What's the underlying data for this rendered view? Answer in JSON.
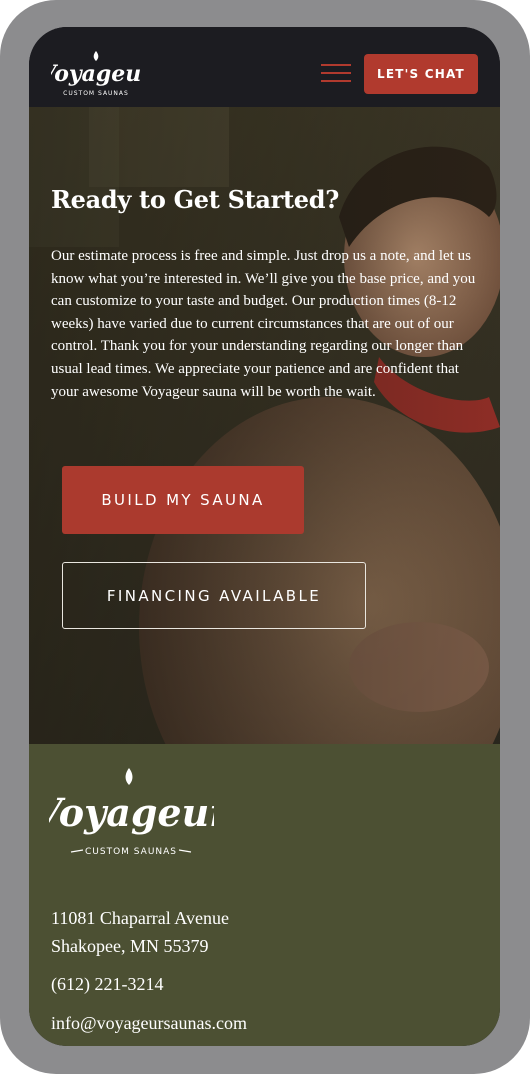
{
  "header": {
    "logo": {
      "word": "Voyageur",
      "tagline": "CUSTOM SAUNAS"
    },
    "menu_icon": "hamburger-menu-icon",
    "chat_button": "LET'S CHAT",
    "accent_color": "#b13a2e"
  },
  "hero": {
    "title": "Ready to Get Started?",
    "text": "Our estimate process is free and simple. Just drop us a note, and let us know what you’re interested in. We’ll give you the base price, and you can customize to your taste and budget. Our production times (8-12 weeks) have varied due to current circumstances that are out of our control. Thank you for your understanding regarding our longer than usual lead times. We appreciate your patience and are confident that your awesome Voyageur sauna will be worth the wait.",
    "primary_button": "BUILD MY SAUNA",
    "secondary_button": "FINANCING AVAILABLE"
  },
  "footer": {
    "logo": {
      "word": "Voyageur",
      "tagline": "CUSTOM SAUNAS"
    },
    "address_line1": "11081 Chaparral Avenue",
    "address_line2": "Shakopee, MN 55379",
    "phone": "(612) 221-3214",
    "email": "info@voyageursaunas.com",
    "background_color": "#4c5033"
  }
}
